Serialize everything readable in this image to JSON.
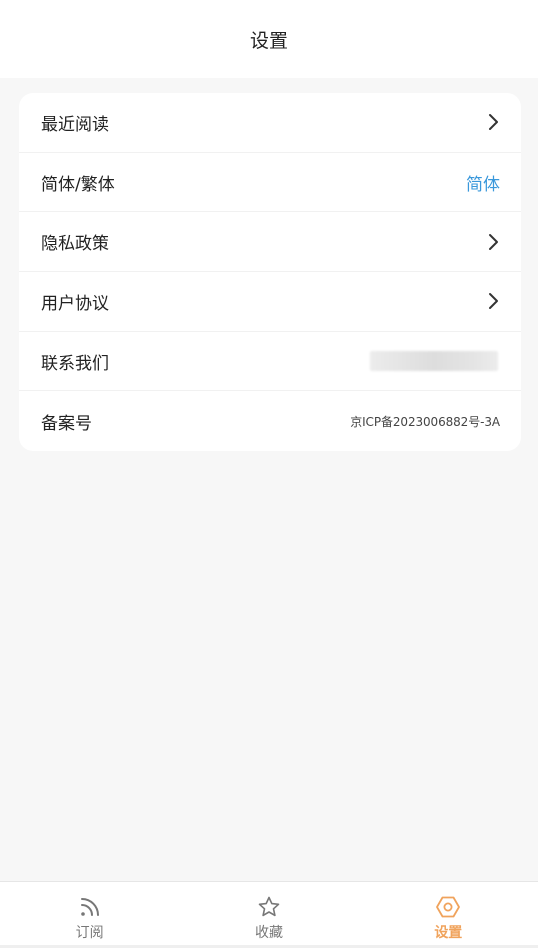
{
  "header": {
    "title": "设置"
  },
  "settings": {
    "items": [
      {
        "label": "最近阅读",
        "type": "chevron"
      },
      {
        "label": "简体/繁体",
        "type": "value",
        "value": "简体"
      },
      {
        "label": "隐私政策",
        "type": "chevron"
      },
      {
        "label": "用户协议",
        "type": "chevron"
      },
      {
        "label": "联系我们",
        "type": "blurred"
      },
      {
        "label": "备案号",
        "type": "value-small",
        "value": "京ICP备2023006882号-3A"
      }
    ]
  },
  "tabbar": {
    "tabs": [
      {
        "label": "订阅",
        "icon": "rss-icon",
        "active": false
      },
      {
        "label": "收藏",
        "icon": "star-icon",
        "active": false
      },
      {
        "label": "设置",
        "icon": "hexagon-settings-icon",
        "active": true
      }
    ]
  },
  "colors": {
    "accent_blue": "#3a98db",
    "active_tab": "#f0a35c",
    "inactive_tab": "#777777"
  }
}
